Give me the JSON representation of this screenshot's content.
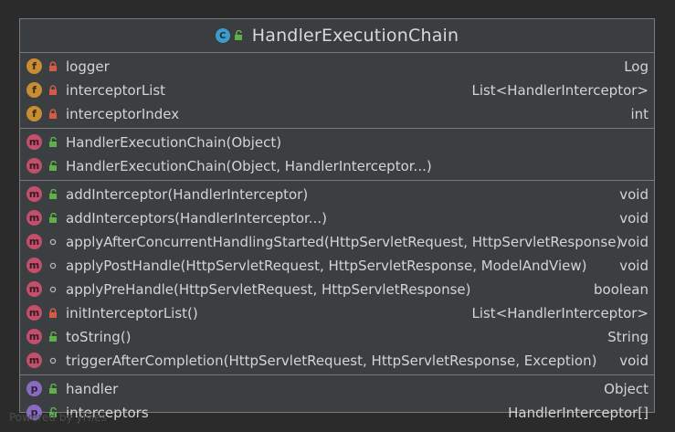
{
  "class_name": "HandlerExecutionChain",
  "class_icon": "C",
  "colors": {
    "background": "#2b2b2b",
    "panel": "#3c3f41",
    "field_badge": "#c88d33",
    "method_badge": "#c24f6b",
    "property_badge": "#8a6bc1",
    "public": "#5fb04a",
    "private": "#d65a4a"
  },
  "fields": [
    {
      "badge": "f",
      "visibility": "private",
      "name": "logger",
      "type": "Log"
    },
    {
      "badge": "f",
      "visibility": "private",
      "name": "interceptorList",
      "type": "List<HandlerInterceptor>"
    },
    {
      "badge": "f",
      "visibility": "private",
      "name": "interceptorIndex",
      "type": "int"
    }
  ],
  "constructors": [
    {
      "badge": "m",
      "visibility": "public",
      "name": "HandlerExecutionChain(Object)",
      "type": ""
    },
    {
      "badge": "m",
      "visibility": "public",
      "name": "HandlerExecutionChain(Object, HandlerInterceptor...)",
      "type": ""
    }
  ],
  "methods": [
    {
      "badge": "m",
      "visibility": "public",
      "name": "addInterceptor(HandlerInterceptor)",
      "type": "void"
    },
    {
      "badge": "m",
      "visibility": "public",
      "name": "addInterceptors(HandlerInterceptor...)",
      "type": "void"
    },
    {
      "badge": "m",
      "visibility": "package",
      "name": "applyAfterConcurrentHandlingStarted(HttpServletRequest, HttpServletResponse)",
      "type": "void"
    },
    {
      "badge": "m",
      "visibility": "package",
      "name": "applyPostHandle(HttpServletRequest, HttpServletResponse, ModelAndView)",
      "type": "void"
    },
    {
      "badge": "m",
      "visibility": "package",
      "name": "applyPreHandle(HttpServletRequest, HttpServletResponse)",
      "type": "boolean"
    },
    {
      "badge": "m",
      "visibility": "private",
      "name": "initInterceptorList()",
      "type": "List<HandlerInterceptor>"
    },
    {
      "badge": "m",
      "visibility": "public",
      "name": "toString()",
      "type": "String"
    },
    {
      "badge": "m",
      "visibility": "package",
      "name": "triggerAfterCompletion(HttpServletRequest, HttpServletResponse, Exception)",
      "type": "void"
    }
  ],
  "properties": [
    {
      "badge": "p",
      "visibility": "public",
      "name": "handler",
      "type": "Object"
    },
    {
      "badge": "p",
      "visibility": "public",
      "name": "interceptors",
      "type": "HandlerInterceptor[]"
    }
  ],
  "watermark": "Powered by yFiles"
}
